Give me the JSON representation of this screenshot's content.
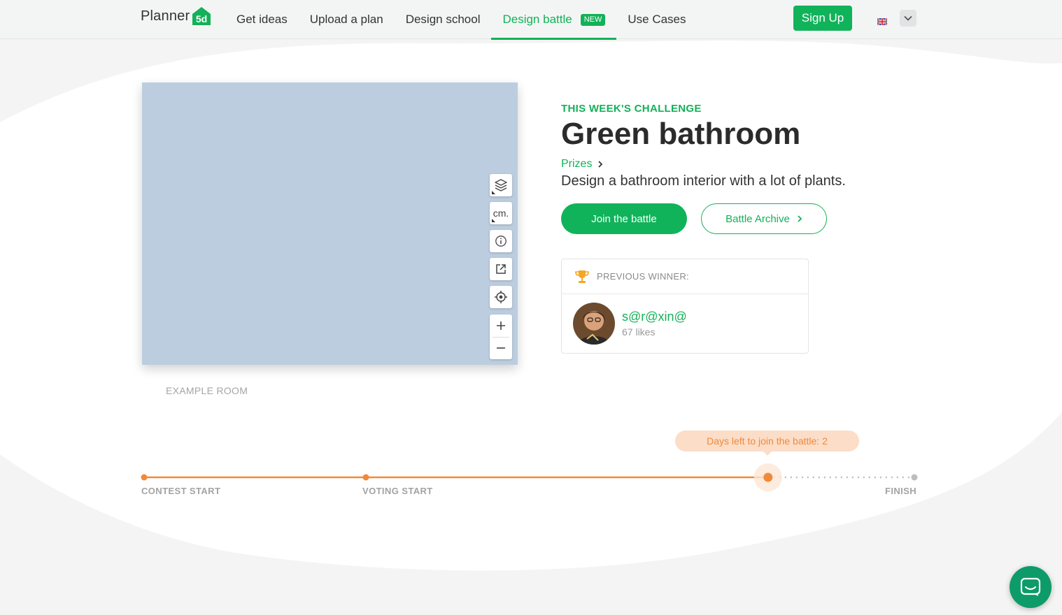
{
  "header": {
    "logo_text": "Planner",
    "logo_mark": "5d",
    "nav": [
      {
        "label": "Get ideas"
      },
      {
        "label": "Upload a plan"
      },
      {
        "label": "Design school"
      },
      {
        "label": "Design battle",
        "badge": "NEW",
        "active": true
      },
      {
        "label": "Use Cases"
      }
    ],
    "signup_label": "Sign Up",
    "language_icon": "uk-flag-icon"
  },
  "viewer": {
    "tools": [
      "layers-icon",
      "units-button",
      "info-icon",
      "external-link-icon",
      "locate-icon",
      "zoom-in-icon",
      "zoom-out-icon"
    ],
    "units_label": "cm.",
    "caption": "EXAMPLE ROOM"
  },
  "challenge": {
    "eyebrow": "THIS WEEK'S CHALLENGE",
    "title": "Green bathroom",
    "prizes_label": "Prizes",
    "description": "Design a bathroom interior with a lot of plants.",
    "join_label": "Join the battle",
    "archive_label": "Battle Archive"
  },
  "winner": {
    "heading": "PREVIOUS WINNER:",
    "name": "s@r@xin@",
    "likes": "67 likes"
  },
  "timeline": {
    "tooltip": "Days left to join the battle: 2",
    "labels": {
      "start": "CONTEST START",
      "voting": "VOTING START",
      "finish": "FINISH"
    },
    "progress_fraction": 0.81
  },
  "colors": {
    "brand_green": "#13b158",
    "progress_orange": "#f08a3b",
    "viewer_bg": "#bccddf"
  }
}
